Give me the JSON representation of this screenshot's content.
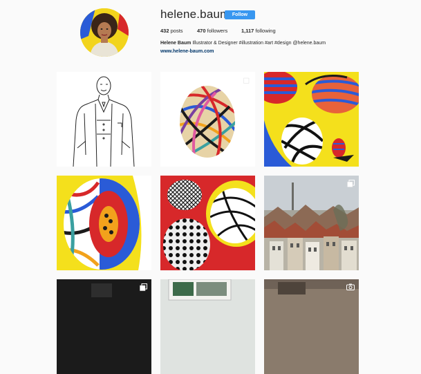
{
  "profile": {
    "username": "helene.baum",
    "follow_label": "Follow",
    "posts_count": "432",
    "posts_label": "posts",
    "followers_count": "470",
    "followers_label": "followers",
    "following_count": "1,117",
    "following_label": "following",
    "full_name": "Helene Baum",
    "bio_text": "Illustrator & Designer #illustration #art #design @helene.baum",
    "website": "www.helene-baum.com"
  },
  "colors": {
    "follow_button": "#3897f0",
    "link": "#003569",
    "background": "#fafafa"
  },
  "posts": [
    {
      "name": "post-man-drawing",
      "icon": null
    },
    {
      "name": "post-striped-egg",
      "icon": "multiple-photos-icon"
    },
    {
      "name": "post-yellow-eggs",
      "icon": null
    },
    {
      "name": "post-split-egg",
      "icon": null
    },
    {
      "name": "post-red-eggs",
      "icon": null
    },
    {
      "name": "post-city-rooftops",
      "icon": "multiple-photos-icon"
    },
    {
      "name": "post-dark-room",
      "icon": "multiple-photos-icon"
    },
    {
      "name": "post-photo-print",
      "icon": null
    },
    {
      "name": "post-workspace",
      "icon": "camera-icon"
    }
  ]
}
